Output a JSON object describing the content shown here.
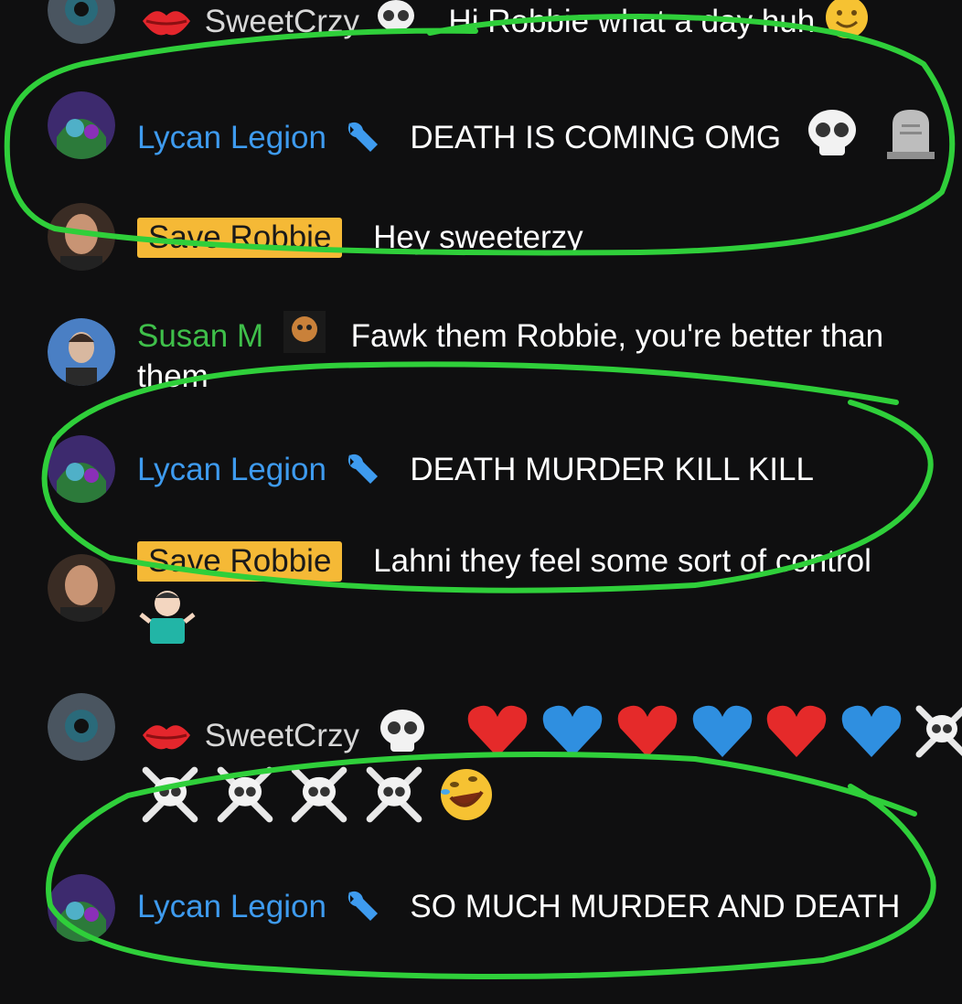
{
  "messages": [
    {
      "id": "m0",
      "user": "SweetCrzy",
      "text": "Hi Robbie what a day huh"
    },
    {
      "id": "m1",
      "user": "Lycan Legion",
      "text": "DEATH IS COMING OMG"
    },
    {
      "id": "m2",
      "user": "Save Robbie",
      "text": "Hey sweeterzy"
    },
    {
      "id": "m3",
      "user": "Susan M",
      "text": "Fawk them Robbie, you're better than",
      "text_cont": "them"
    },
    {
      "id": "m4",
      "user": "Lycan Legion",
      "text": "DEATH MURDER KILL KILL"
    },
    {
      "id": "m5",
      "user": "Save Robbie",
      "text": "Lahni they feel some sort of control"
    },
    {
      "id": "m6",
      "user": "SweetCrzy"
    },
    {
      "id": "m7",
      "user": "Lycan Legion",
      "text": "SO MUCH MURDER AND DEATH"
    }
  ],
  "colors": {
    "background": "#0f0f10",
    "mod_name": "#3e9bef",
    "green_name": "#3fbf4a",
    "highlight_badge": "#f5b936",
    "annotation": "#2fcf3a"
  },
  "icons": {
    "wrench": "wrench-icon",
    "skull": "skull-icon",
    "tombstone": "tombstone-icon",
    "lips": "lips-icon",
    "red_heart": "red-heart-icon",
    "blue_heart": "blue-heart-icon",
    "skull_crossbones": "skull-crossbones-icon",
    "laughing": "rofl-icon",
    "shrug": "shrug-icon"
  }
}
